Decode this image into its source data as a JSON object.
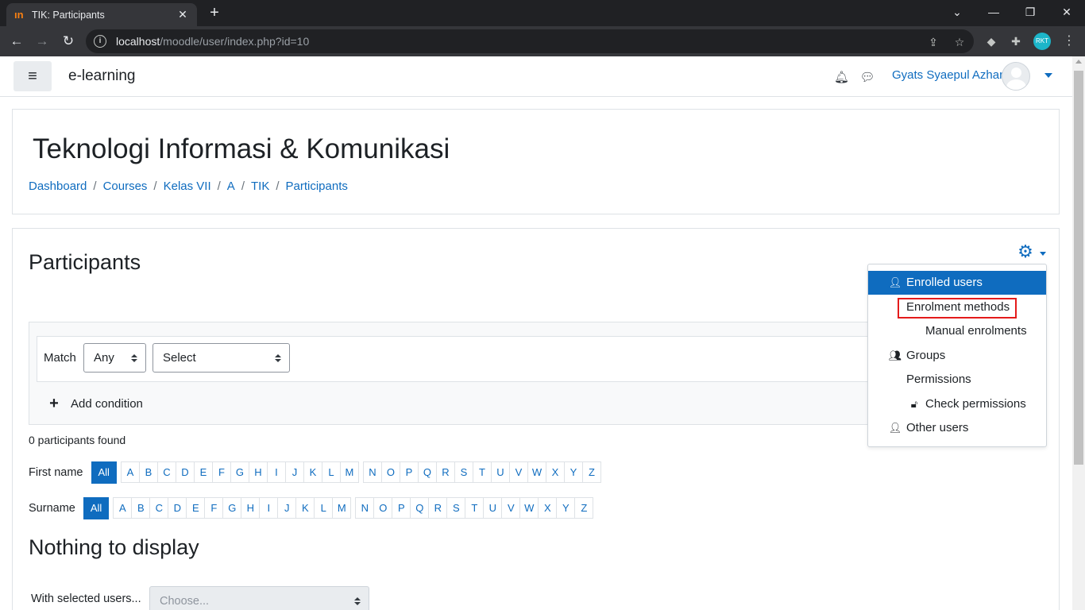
{
  "browser": {
    "tab_title": "TIK: Participants",
    "tab_favicon": "ın",
    "url_host": "localhost",
    "url_path": "/moodle/user/index.php?id=10",
    "profile_label": "RKT"
  },
  "navbar": {
    "brand": "e-learning",
    "user_name": "Gyats Syaepul Azhar"
  },
  "header": {
    "course_title": "Teknologi Informasi & Komunikasi",
    "breadcrumb": [
      "Dashboard",
      "Courses",
      "Kelas VII",
      "A",
      "TIK",
      "Participants"
    ],
    "breadcrumb_sep": "/"
  },
  "main": {
    "title": "Participants",
    "filter": {
      "match_label": "Match",
      "match_value": "Any",
      "select_value": "Select",
      "add_condition": "Add condition"
    },
    "found_text": "0 participants found",
    "first_name_label": "First name",
    "surname_label": "Surname",
    "initials": [
      "All",
      "A",
      "B",
      "C",
      "D",
      "E",
      "F",
      "G",
      "H",
      "I",
      "J",
      "K",
      "L",
      "M",
      "N",
      "O",
      "P",
      "Q",
      "R",
      "S",
      "T",
      "U",
      "V",
      "W",
      "X",
      "Y",
      "Z"
    ],
    "nothing_text": "Nothing to display",
    "with_selected_label": "With selected users...",
    "choose_placeholder": "Choose..."
  },
  "menu": {
    "items": [
      {
        "label": "Enrolled users",
        "icon": "user-plus-icon",
        "active": true
      },
      {
        "label": "Enrolment methods",
        "icon": "",
        "highlighted": true
      },
      {
        "label": "Manual enrolments",
        "icon": ""
      },
      {
        "label": "Groups",
        "icon": "users-icon"
      },
      {
        "label": "Permissions",
        "icon": ""
      },
      {
        "label": "Check permissions",
        "icon": "unlock-icon"
      },
      {
        "label": "Other users",
        "icon": "user-plus-icon"
      }
    ]
  },
  "colors": {
    "primary": "#0f6cbf",
    "highlight_box": "#e41b1b",
    "chrome_dark": "#202124"
  }
}
